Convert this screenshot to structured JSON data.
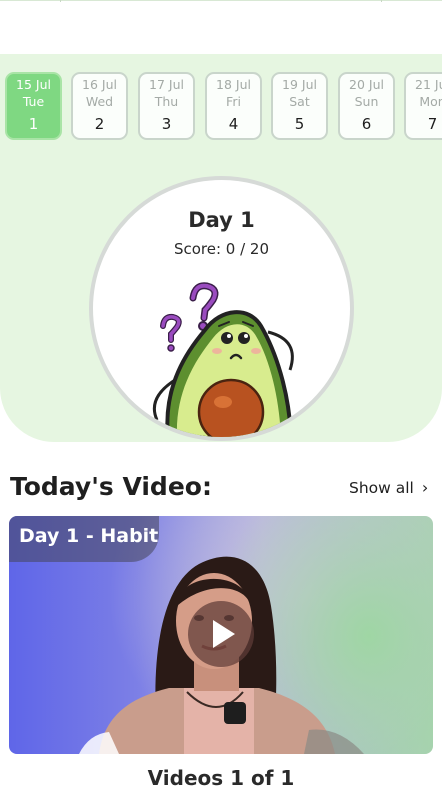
{
  "days": [
    {
      "date": "15 Jul",
      "weekday": "Tue",
      "number": "1",
      "active": true
    },
    {
      "date": "16 Jul",
      "weekday": "Wed",
      "number": "2",
      "active": false
    },
    {
      "date": "17 Jul",
      "weekday": "Thu",
      "number": "3",
      "active": false
    },
    {
      "date": "18 Jul",
      "weekday": "Fri",
      "number": "4",
      "active": false
    },
    {
      "date": "19 Jul",
      "weekday": "Sat",
      "number": "5",
      "active": false
    },
    {
      "date": "20 Jul",
      "weekday": "Sun",
      "number": "6",
      "active": false
    },
    {
      "date": "21 Jul",
      "weekday": "Mon",
      "number": "7",
      "active": false
    }
  ],
  "progress": {
    "day_title": "Day 1",
    "score": "Score: 0 / 20",
    "mascot": "avocado-thinking-icon"
  },
  "video_section": {
    "title": "Today's Video:",
    "show_all": "Show all",
    "video_badge": "Day 1 - Habit",
    "play_icon": "play-icon",
    "counter": "Videos 1 of 1"
  },
  "colors": {
    "panel_bg": "#e6f6e1",
    "active_day": "#7fd882",
    "text": "#1f1f1f"
  }
}
